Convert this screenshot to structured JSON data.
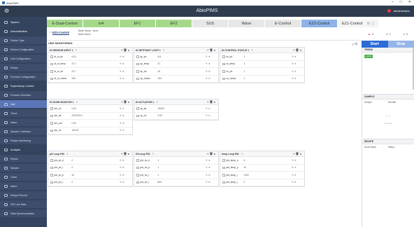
{
  "window": {
    "title": "AbioPIMS"
  },
  "app": {
    "title": "AbioPIMS",
    "user": "Administrator"
  },
  "sidebar": [
    {
      "label": "System",
      "kind": "head"
    },
    {
      "label": "Administration",
      "kind": "head"
    },
    {
      "label": "Device Type",
      "kind": "sub"
    },
    {
      "label": "Device Configuration",
      "kind": "sub"
    },
    {
      "label": "Unit Configuration",
      "kind": "sub"
    },
    {
      "label": "Recipe",
      "kind": "sub"
    },
    {
      "label": "Formula Configuration",
      "kind": "sub"
    },
    {
      "label": "Supervisory Control",
      "kind": "head"
    },
    {
      "label": "Process Overview",
      "kind": "sub"
    },
    {
      "label": "Unit",
      "kind": "active"
    },
    {
      "label": "Trend",
      "kind": "sub"
    },
    {
      "label": "Alarm",
      "kind": "sub"
    },
    {
      "label": "Sample Collection",
      "kind": "sub"
    },
    {
      "label": "Recipe Monitoring",
      "kind": "sub"
    },
    {
      "label": "Analysis",
      "kind": "head"
    },
    {
      "label": "Report",
      "kind": "sub"
    },
    {
      "label": "Sample",
      "kind": "sub"
    },
    {
      "label": "Chart",
      "kind": "sub"
    },
    {
      "label": "Alarm",
      "kind": "sub"
    },
    {
      "label": "Recipe Record",
      "kind": "sub"
    },
    {
      "label": "OPI Live Data",
      "kind": "sub"
    },
    {
      "label": "Data Synchronization",
      "kind": "sub"
    }
  ],
  "tabs": [
    {
      "label": "E-Dual-Control",
      "style": "green",
      "w": 52
    },
    {
      "label": "m4",
      "style": "green",
      "w": 52
    },
    {
      "label": "EF1",
      "style": "green",
      "w": 52
    },
    {
      "label": "EF2",
      "style": "green",
      "w": 52
    },
    {
      "label": "SUS",
      "style": "grey",
      "w": 52
    },
    {
      "label": "Wave",
      "style": "grey",
      "w": 52
    },
    {
      "label": "E-Control",
      "style": "grey",
      "w": 52
    },
    {
      "label": "EZ2-Control",
      "style": "blue",
      "w": 52
    },
    {
      "label": "EZ1-Control",
      "style": "plain",
      "w": 59
    }
  ],
  "subhead": {
    "home": "⌂",
    "unit": "EZ2-Control",
    "batch_status": "Batch Status : None",
    "batch_name": "Batch Name :"
  },
  "status": [
    {
      "icon": "▲",
      "color": "#e53e3e",
      "value": "0"
    },
    {
      "icon": "●",
      "color": "#3aa845",
      "value": "0"
    },
    {
      "icon": "●",
      "color": "#888",
      "value": "0"
    }
  ],
  "section": {
    "title": "UNIT MONITORING",
    "tools": "⤢ ⬚"
  },
  "panels": [
    {
      "title": "DI SENSOR INPUT 1",
      "rows": [
        [
          "di_m_ph",
          "6.51"
        ],
        [
          "di_m_temp",
          "37.7"
        ],
        [
          "di_m_do",
          "22.7"
        ],
        [
          "di_m_rdosw",
          "945"
        ]
      ]
    },
    {
      "title": "DI SETPOINT LOOP 1",
      "rows": [
        [
          "sp_ph",
          "6.6"
        ],
        [
          "sp_temp",
          "37"
        ],
        [
          "sp_do",
          "40"
        ],
        [
          "sp_rdosw",
          "300"
        ]
      ]
    },
    {
      "title": "DI CONTROL STATUS 1",
      "rows": [
        [
          "cs_ph",
          "1"
        ],
        [
          "cs_temp",
          "1"
        ],
        [
          "cs_do",
          "1"
        ],
        [
          "cs_rdosw",
          "1"
        ]
      ]
    },
    {
      "title": "DI DOSE MONITOR 1",
      "rows": [
        [
          "dm_o2",
          "0.00"
        ],
        [
          "dm_air",
          "4787003.2"
        ],
        [
          "dm_co2",
          "0.00"
        ],
        [
          "dm_n2",
          "105.87"
        ]
      ]
    },
    {
      "title": "DI ACTUATOR 1",
      "rows": [
        [
          "sp_air",
          "20000"
        ],
        [
          "sp_o2",
          "0.00"
        ]
      ]
    },
    {
      "title": "pH Loop PID",
      "rows": [
        [
          "pid_ph_d",
          "0"
        ],
        [
          "pid_ph_i",
          "0"
        ],
        [
          "pid_ph_p",
          "40"
        ],
        [
          "pid_ph_r",
          "0"
        ]
      ]
    },
    {
      "title": "DO-loop PID",
      "rows": [
        [
          "pid_do_d",
          "1"
        ],
        [
          "pid_do_p",
          "1"
        ],
        [
          "pid_do_i",
          "1"
        ],
        [
          "pid_do_l",
          "800"
        ]
      ]
    },
    {
      "title": "temp Loop PID",
      "rows": [
        [
          "pid_temp_d",
          "5"
        ],
        [
          "pid_temp_p",
          "20"
        ],
        [
          "pid_temp_i",
          "1100"
        ],
        [
          "pid_temp_l",
          "0"
        ]
      ]
    }
  ],
  "right": {
    "start": "Start",
    "stop": "Stop",
    "trend": "TREND",
    "trend_chip": "m_ph/m..",
    "sample": "SAMPLE",
    "sample_cols": [
      "Sample",
      "Number"
    ],
    "nodata": "No Data",
    "recipe": "RECIPE",
    "recipe_cols": [
      "Node Name",
      "Status"
    ]
  }
}
